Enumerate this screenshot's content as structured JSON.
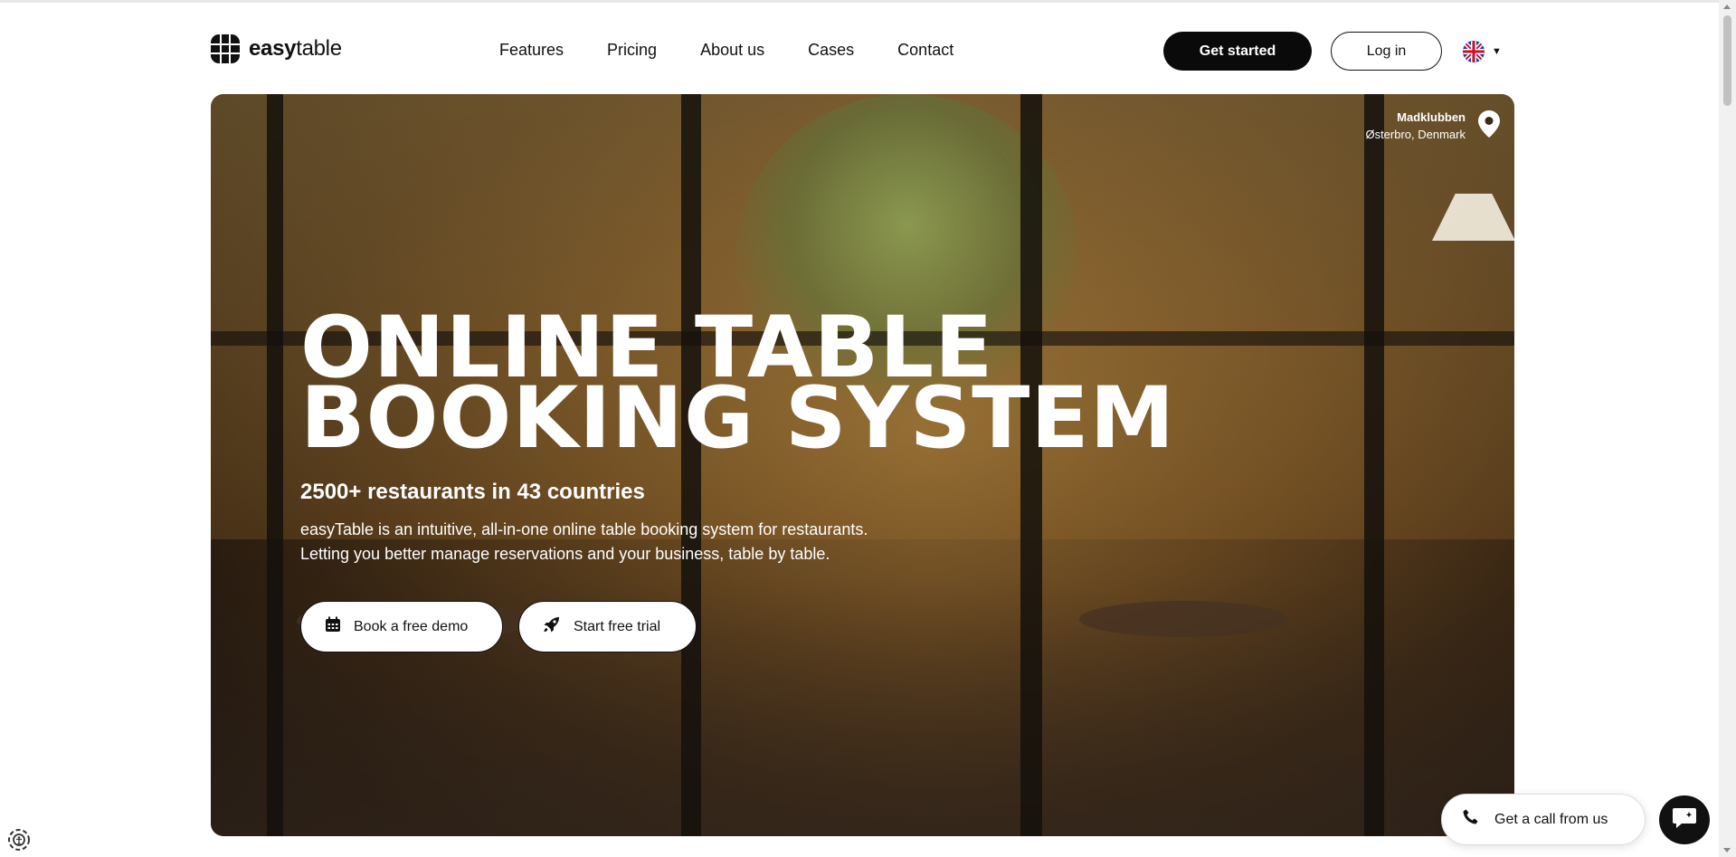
{
  "brand": {
    "logo_bold": "easy",
    "logo_light": "table"
  },
  "nav": {
    "items": [
      "Features",
      "Pricing",
      "About us",
      "Cases",
      "Contact"
    ]
  },
  "header": {
    "get_started": "Get started",
    "login": "Log in",
    "language_icon": "uk-flag-icon"
  },
  "hero": {
    "location_name": "Madklubben",
    "location_place": "Østerbro, Denmark",
    "title_line1": "ONLINE TABLE",
    "title_line2": "BOOKING SYSTEM",
    "subtitle": "2500+ restaurants in 43 countries",
    "desc_line1": "easyTable is an intuitive, all-in-one online table booking system for restaurants.",
    "desc_line2": "Letting you better manage reservations and your business, table by table.",
    "cta_demo": "Book a free demo",
    "cta_trial": "Start free trial"
  },
  "widgets": {
    "call_label": "Get a call from us"
  },
  "colors": {
    "primary": "#0a0a0a",
    "background": "#ffffff",
    "hero_overlay_text": "#ffffff"
  }
}
